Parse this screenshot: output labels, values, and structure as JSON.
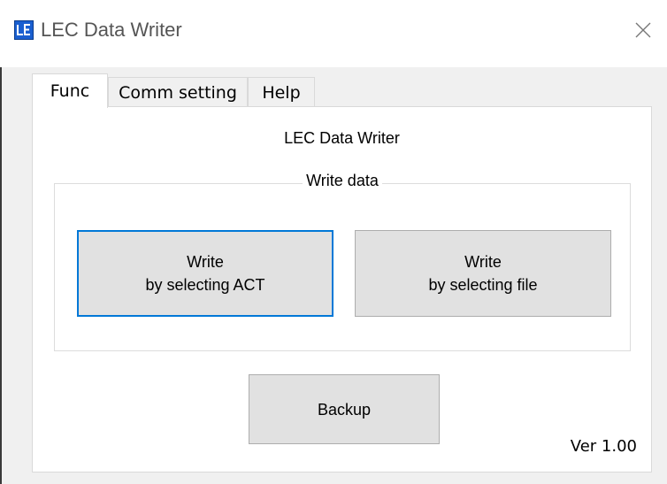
{
  "window": {
    "title": "LEC Data Writer",
    "icon": "le-app-icon",
    "close_icon": "close-icon"
  },
  "tabs": [
    {
      "label": "Func",
      "active": true
    },
    {
      "label": "Comm setting",
      "active": false
    },
    {
      "label": "Help",
      "active": false
    }
  ],
  "panel": {
    "heading": "LEC Data Writer",
    "write_group": {
      "label": "Write data",
      "buttons": [
        {
          "line1": "Write",
          "line2": "by selecting ACT",
          "focused": true
        },
        {
          "line1": "Write",
          "line2": "by selecting file",
          "focused": false
        }
      ]
    },
    "backup_label": "Backup",
    "version": "Ver 1.00"
  },
  "colors": {
    "focus_border": "#0078d7",
    "button_face": "#e1e1e1",
    "icon_blue": "#1a5fd0"
  }
}
